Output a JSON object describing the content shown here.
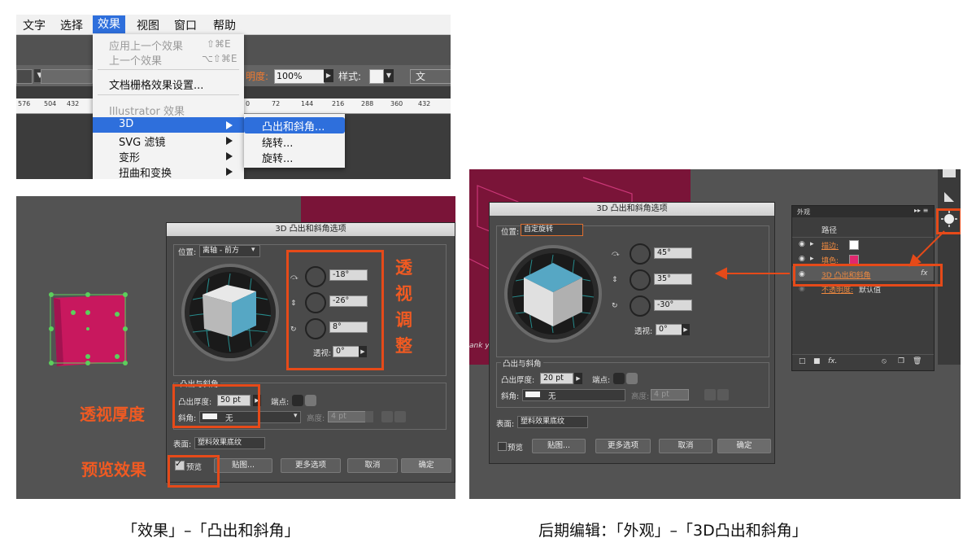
{
  "menu": {
    "bar": [
      "文字",
      "选择",
      "效果",
      "视图",
      "窗口",
      "帮助"
    ],
    "active": "效果",
    "dropdown": {
      "apply_last": "应用上一个效果",
      "apply_last_shortcut": "⇧⌘E",
      "last_effect": "上一个效果",
      "last_effect_shortcut": "⌥⇧⌘E",
      "raster_settings": "文档栅格效果设置...",
      "section_header": "Illustrator 效果",
      "item_3d": "3D",
      "item_svg": "SVG 滤镜",
      "item_distort": "变形",
      "item_twist": "扭曲和变换"
    },
    "submenu": [
      "凸出和斜角...",
      "绕转...",
      "旋转..."
    ],
    "control_bar": {
      "opacity_label": "明度:",
      "opacity_value": "100%",
      "style_label": "样式:",
      "doc_label": "文"
    },
    "ruler_ticks": [
      "576",
      "504",
      "432",
      "0",
      "72",
      "144",
      "216",
      "288",
      "360",
      "432"
    ]
  },
  "left_dialog": {
    "title": "3D 凸出和斜角选项",
    "position_label": "位置:",
    "position_value": "离轴 - 前方",
    "rot_x": "-18°",
    "rot_y": "-26°",
    "rot_z": "8°",
    "perspective_label": "透视:",
    "perspective_value": "0°",
    "section_extrude": "凸出与斜角",
    "depth_label": "凸出厚度:",
    "depth_value": "50 pt",
    "cap_label": "端点:",
    "bevel_label": "斜角:",
    "bevel_value": "无",
    "height_label": "高度:",
    "height_value": "4 pt",
    "surface_label": "表面:",
    "surface_value": "塑料效果底纹",
    "preview_label": "预览",
    "btn_map": "贴图...",
    "btn_more": "更多选项",
    "btn_cancel": "取消",
    "btn_ok": "确定"
  },
  "annotations": {
    "perspective_adjust": [
      "透",
      "视",
      "调",
      "整"
    ],
    "depth": "透视厚度",
    "preview": "预览效果"
  },
  "right_dialog": {
    "title": "3D 凸出和斜角选项",
    "position_label": "位置:",
    "position_value": "自定旋转",
    "rot_x": "45°",
    "rot_y": "35°",
    "rot_z": "-30°",
    "perspective_label": "透视:",
    "perspective_value": "0°",
    "section_extrude": "凸出与斜角",
    "depth_label": "凸出厚度:",
    "depth_value": "20 pt",
    "cap_label": "端点:",
    "bevel_label": "斜角:",
    "bevel_value": "无",
    "height_label": "高度:",
    "height_value": "4 pt",
    "surface_label": "表面:",
    "surface_value": "塑料效果底纹",
    "preview_label": "预览",
    "btn_map": "贴图...",
    "btn_more": "更多选项",
    "btn_cancel": "取消",
    "btn_ok": "确定"
  },
  "appearance_panel": {
    "tab": "外观",
    "title": "路径",
    "stroke_label": "描边:",
    "fill_label": "填色:",
    "effect_3d": "3D 凸出和斜角",
    "fx": "fx",
    "opacity_label": "不透明度:",
    "opacity_value": "默认值"
  },
  "bg_text": "ank yo",
  "captions": {
    "left": "「效果」–「凸出和斜角」",
    "right": "后期编辑：「外观」–「3D凸出和斜角」"
  },
  "colors": {
    "accent_orange": "#e64a19",
    "magenta": "#c8185e",
    "menu_highlight": "#2e6fdc",
    "cube_top": "#e8e8e8",
    "cube_side": "#56a7c4"
  }
}
